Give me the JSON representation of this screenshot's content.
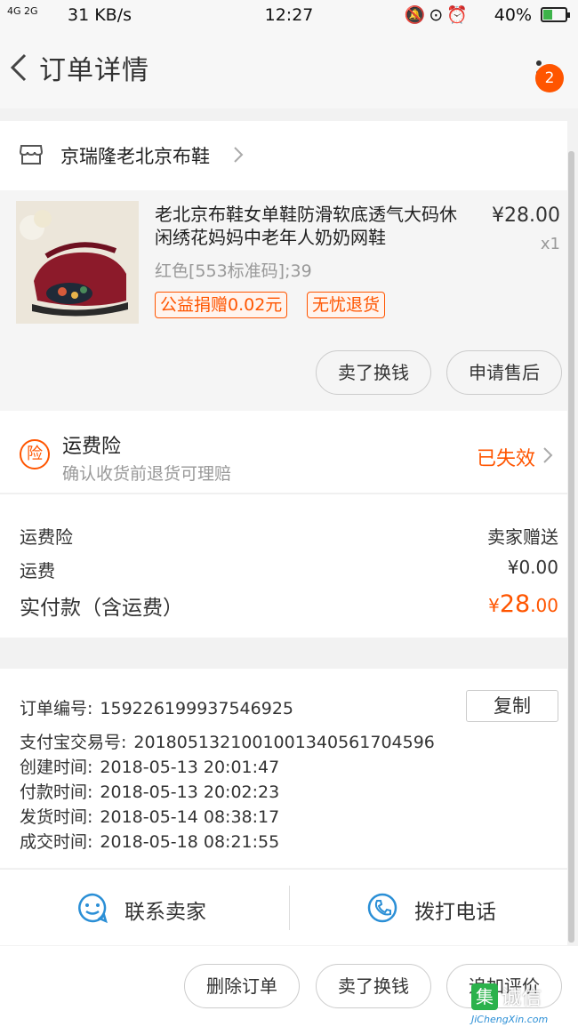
{
  "status_bar": {
    "network": "4G 2G",
    "speed": "31 KB/s",
    "time": "12:27",
    "battery": "40%",
    "battery_level": 0.4
  },
  "header": {
    "title": "订单详情",
    "notification_count": "2"
  },
  "shop": {
    "name": "京瑞隆老北京布鞋"
  },
  "product": {
    "title": "老北京布鞋女单鞋防滑软底透气大码休闲绣花妈妈中老年人奶奶网鞋",
    "price": "¥28.00",
    "quantity": "x1",
    "sku": "红色[553标准码];39",
    "tags": [
      "公益捐赠0.02元",
      "无忧退货"
    ],
    "actions": [
      "卖了换钱",
      "申请售后"
    ]
  },
  "insurance": {
    "icon_text": "险",
    "title": "运费险",
    "subtitle": "确认收货前退货可理赔",
    "status": "已失效"
  },
  "fees": {
    "rows": [
      {
        "label": "运费险",
        "value": "卖家赠送"
      },
      {
        "label": "运费",
        "value": "¥0.00"
      }
    ],
    "total_label": "实付款（含运费）",
    "total_currency": "¥",
    "total_int": "28",
    "total_dec": ".00"
  },
  "order_info": {
    "copy_label": "复制",
    "rows": [
      {
        "label": "订单编号:",
        "value": "159226199937546925"
      },
      {
        "label": "支付宝交易号:",
        "value": "2018051321001001340561704596"
      },
      {
        "label": "创建时间:",
        "value": "2018-05-13 20:01:47"
      },
      {
        "label": "付款时间:",
        "value": "2018-05-13 20:02:23"
      },
      {
        "label": "发货时间:",
        "value": "2018-05-14 08:38:17"
      },
      {
        "label": "成交时间:",
        "value": "2018-05-18 08:21:55"
      }
    ]
  },
  "contact": {
    "seller_label": "联系卖家",
    "phone_label": "拨打电话"
  },
  "bottom_actions": [
    "删除订单",
    "卖了换钱",
    "追加评价"
  ],
  "watermark": {
    "box_char": "集",
    "text": "诚信",
    "url": "JiChengXin.com"
  },
  "colors": {
    "accent": "#ff5500",
    "text": "#333333",
    "muted": "#999999",
    "background": "#f2f2f2"
  }
}
